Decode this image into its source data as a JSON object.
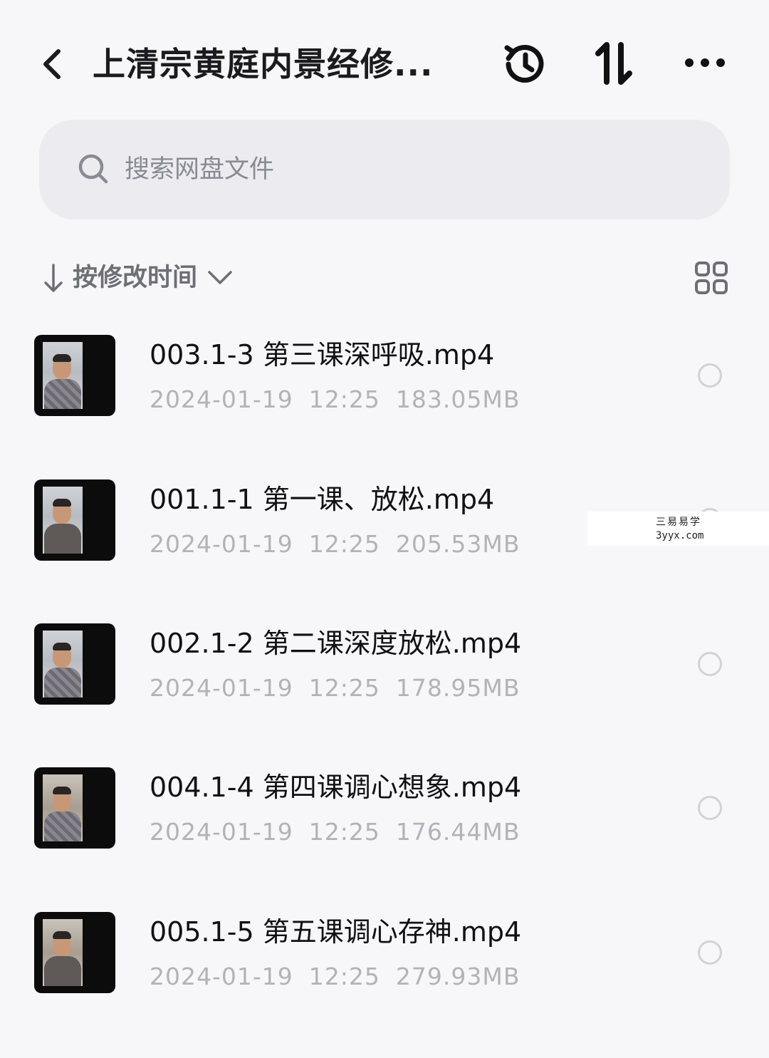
{
  "header": {
    "title": "上清宗黄庭内景经修...",
    "icons": {
      "back": "chevron-left-icon",
      "history": "history-icon",
      "sort": "sort-arrows-icon",
      "more": "more-dots-icon"
    }
  },
  "search": {
    "placeholder": "搜索网盘文件",
    "icon": "search-icon"
  },
  "sort": {
    "label": "按修改时间",
    "direction_icon": "arrow-down-icon",
    "dropdown_icon": "chevron-down-icon",
    "view_icon": "grid-view-icon"
  },
  "files": [
    {
      "name": "003.1-3 第三课深呼吸.mp4",
      "date": "2024-01-19",
      "time": "12:25",
      "size": "183.05MB"
    },
    {
      "name": "001.1-1 第一课、放松.mp4",
      "date": "2024-01-19",
      "time": "12:25",
      "size": "205.53MB"
    },
    {
      "name": "002.1-2 第二课深度放松.mp4",
      "date": "2024-01-19",
      "time": "12:25",
      "size": "178.95MB"
    },
    {
      "name": "004.1-4 第四课调心想象.mp4",
      "date": "2024-01-19",
      "time": "12:25",
      "size": "176.44MB"
    },
    {
      "name": "005.1-5 第五课调心存神.mp4",
      "date": "2024-01-19",
      "time": "12:25",
      "size": "279.93MB"
    }
  ],
  "watermark": {
    "line1": "三易易学",
    "line2": "3yyx.com"
  },
  "colors": {
    "background": "#f7f7f9",
    "search_bg": "#ececf0",
    "primary_text": "#111115",
    "secondary_text": "#b2b2b8"
  }
}
